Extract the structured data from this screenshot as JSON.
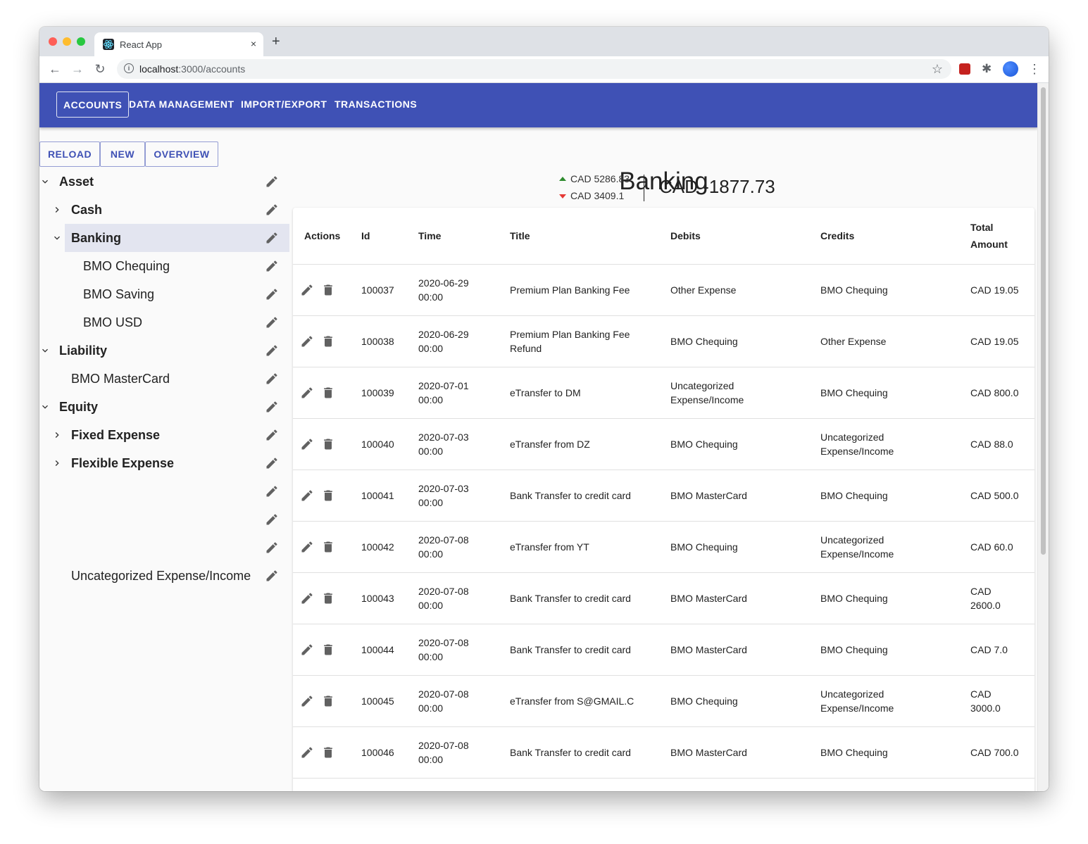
{
  "browser": {
    "tab_title": "React App",
    "tab_close": "×",
    "new_tab": "+",
    "url_host": "localhost",
    "url_rest": ":3000/accounts",
    "back": "←",
    "forward": "→",
    "reload": "↻",
    "star": "☆",
    "menu": "⋮"
  },
  "nav": {
    "items": [
      "ACCOUNTS",
      "DATA MANAGEMENT",
      "IMPORT/EXPORT",
      "TRANSACTIONS"
    ],
    "active": "ACCOUNTS"
  },
  "buttons": {
    "reload": "RELOAD",
    "new": "NEW",
    "overview": "OVERVIEW"
  },
  "tree": [
    {
      "label": "Asset",
      "bold": true,
      "chevron": "down"
    },
    {
      "label": "Cash",
      "bold": true,
      "chevron": "right"
    },
    {
      "label": "Banking",
      "bold": true,
      "chevron": "down",
      "selected": true
    },
    {
      "label": "BMO Chequing",
      "bold": false,
      "chevron": ""
    },
    {
      "label": "BMO Saving",
      "bold": false,
      "chevron": ""
    },
    {
      "label": "BMO USD",
      "bold": false,
      "chevron": ""
    },
    {
      "label": "Liability",
      "bold": true,
      "chevron": "down"
    },
    {
      "label": "BMO MasterCard",
      "bold": false,
      "chevron": ""
    },
    {
      "label": "Equity",
      "bold": true,
      "chevron": "down"
    },
    {
      "label": "Fixed Expense",
      "bold": true,
      "chevron": "right"
    },
    {
      "label": "Flexible Expense",
      "bold": true,
      "chevron": "right"
    },
    {
      "label": "",
      "bold": false,
      "chevron": ""
    },
    {
      "label": "",
      "bold": false,
      "chevron": ""
    },
    {
      "label": "",
      "bold": false,
      "chevron": ""
    },
    {
      "label": "Uncategorized Expense/Income",
      "bold": false,
      "chevron": ""
    }
  ],
  "account": {
    "name": "Banking",
    "debit_total": "CAD 5286.83",
    "credit_total": "CAD 3409.1",
    "balance": "CAD -1877.73"
  },
  "table": {
    "headers": {
      "actions": "Actions",
      "id": "Id",
      "time": "Time",
      "title": "Title",
      "debits": "Debits",
      "credits": "Credits",
      "total_1": "Total",
      "total_2": "Amount"
    },
    "rows": [
      {
        "id": "100037",
        "date": "2020-06-29",
        "time": "00:00",
        "title": "Premium Plan Banking Fee",
        "debit": "Other Expense",
        "credit": "BMO Chequing",
        "amount": "CAD 19.05"
      },
      {
        "id": "100038",
        "date": "2020-06-29",
        "time": "00:00",
        "title": "Premium Plan Banking Fee Refund",
        "debit": "BMO Chequing",
        "credit": "Other Expense",
        "amount": "CAD 19.05"
      },
      {
        "id": "100039",
        "date": "2020-07-01",
        "time": "00:00",
        "title": "eTransfer to DM",
        "debit": "Uncategorized Expense/Income",
        "credit": "BMO Chequing",
        "amount": "CAD 800.0"
      },
      {
        "id": "100040",
        "date": "2020-07-03",
        "time": "00:00",
        "title": "eTransfer from DZ",
        "debit": "BMO Chequing",
        "credit": "Uncategorized Expense/Income",
        "amount": "CAD 88.0"
      },
      {
        "id": "100041",
        "date": "2020-07-03",
        "time": "00:00",
        "title": "Bank Transfer to credit card",
        "debit": "BMO MasterCard",
        "credit": "BMO Chequing",
        "amount": "CAD 500.0"
      },
      {
        "id": "100042",
        "date": "2020-07-08",
        "time": "00:00",
        "title": "eTransfer from YT",
        "debit": "BMO Chequing",
        "credit": "Uncategorized Expense/Income",
        "amount": "CAD 60.0"
      },
      {
        "id": "100043",
        "date": "2020-07-08",
        "time": "00:00",
        "title": "Bank Transfer to credit card",
        "debit": "BMO MasterCard",
        "credit": "BMO Chequing",
        "amount": "CAD 2600.0"
      },
      {
        "id": "100044",
        "date": "2020-07-08",
        "time": "00:00",
        "title": "Bank Transfer to credit card",
        "debit": "BMO MasterCard",
        "credit": "BMO Chequing",
        "amount": "CAD 7.0"
      },
      {
        "id": "100045",
        "date": "2020-07-08",
        "time": "00:00",
        "title": "eTransfer from S@GMAIL.C",
        "debit": "BMO Chequing",
        "credit": "Uncategorized Expense/Income",
        "amount": "CAD 3000.0"
      },
      {
        "id": "100046",
        "date": "2020-07-08",
        "time": "00:00",
        "title": "Bank Transfer to credit card",
        "debit": "BMO MasterCard",
        "credit": "BMO Chequing",
        "amount": "CAD 700.0"
      }
    ]
  },
  "colors": {
    "primary": "#3f51b5",
    "selected_row": "#e3e5f0",
    "up_arrow": "#2e8b2e",
    "down_arrow": "#e53935"
  },
  "icons": {
    "edit": "pencil-icon",
    "delete": "trash-icon",
    "expand": "chevron-down-icon",
    "collapse": "chevron-right-icon"
  }
}
